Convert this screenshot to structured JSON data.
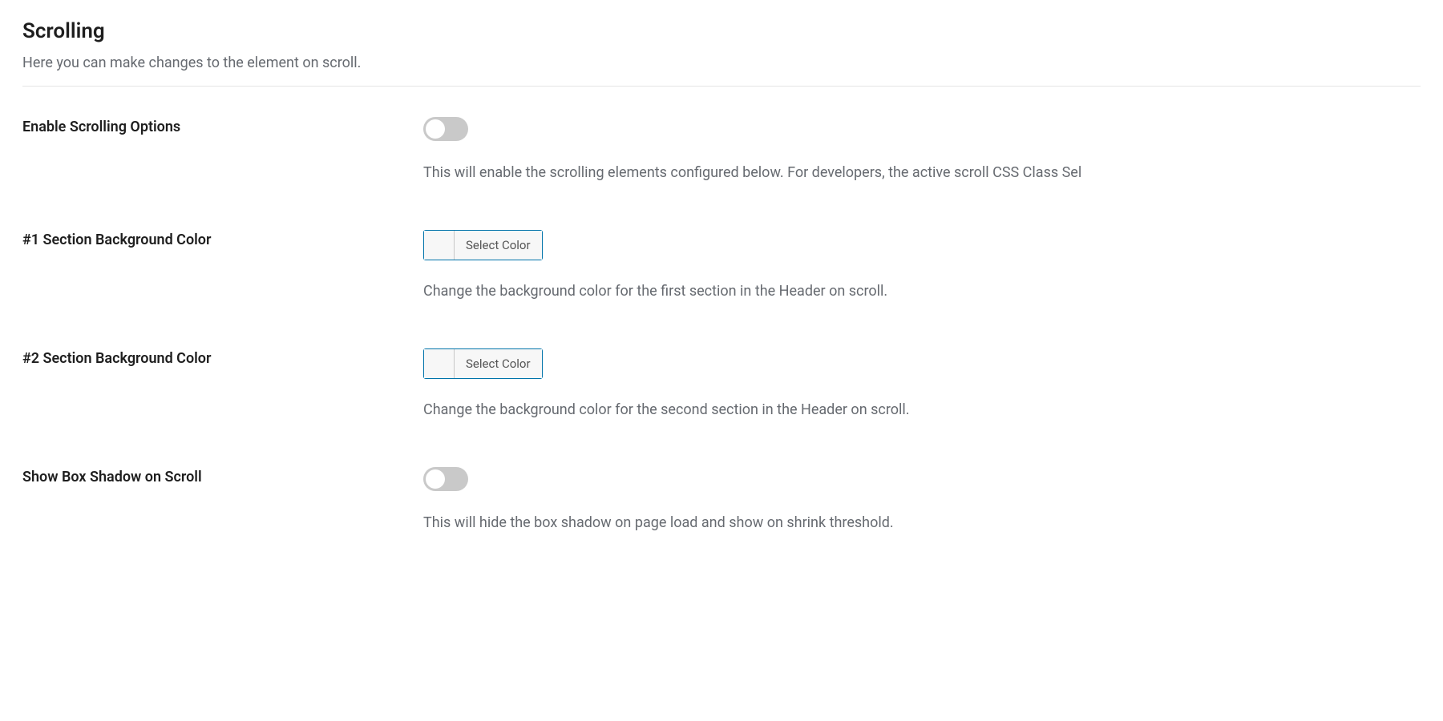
{
  "section": {
    "title": "Scrolling",
    "subtitle": "Here you can make changes to the element on scroll."
  },
  "fields": {
    "enable_scrolling": {
      "label": "Enable Scrolling Options",
      "description": "This will enable the scrolling elements configured below. For developers, the active scroll CSS Class Sel",
      "value": false
    },
    "section1_bg": {
      "label": "#1 Section Background Color",
      "button_label": "Select Color",
      "description": "Change the background color for the first section in the Header on scroll."
    },
    "section2_bg": {
      "label": "#2 Section Background Color",
      "button_label": "Select Color",
      "description": "Change the background color for the second section in the Header on scroll."
    },
    "box_shadow": {
      "label": "Show Box Shadow on Scroll",
      "description": "This will hide the box shadow on page load and show on shrink threshold.",
      "value": false
    }
  }
}
